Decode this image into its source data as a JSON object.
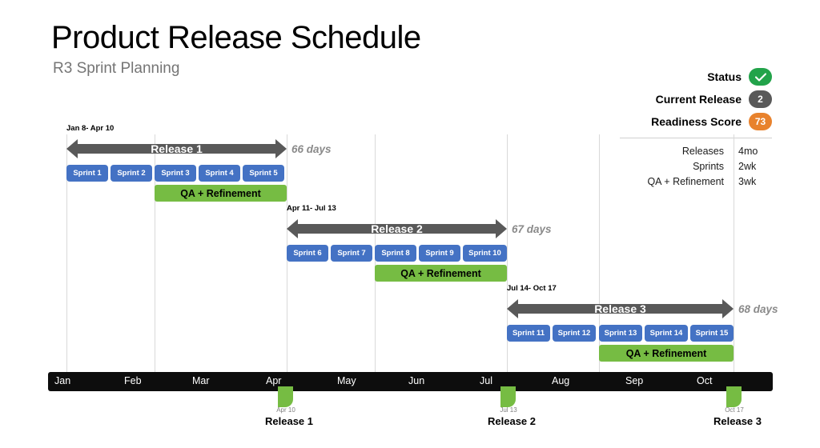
{
  "header": {
    "title": "Product Release Schedule",
    "subtitle": "R3 Sprint Planning"
  },
  "kpis": [
    {
      "label": "Status",
      "value": "",
      "icon": "check-icon",
      "color": "#22A34A",
      "style": "green"
    },
    {
      "label": "Current Release",
      "value": "2",
      "icon": "",
      "color": "#595959",
      "style": "gray"
    },
    {
      "label": "Readiness Score",
      "value": "73",
      "icon": "",
      "color": "#E8822D",
      "style": "orange"
    }
  ],
  "legend": {
    "rows": [
      {
        "name": "Releases",
        "value": "4mo"
      },
      {
        "name": "Sprints",
        "value": "2wk"
      },
      {
        "name": "QA + Refinement",
        "value": "3wk"
      }
    ]
  },
  "chart_data": {
    "type": "bar",
    "title": "Product Release Schedule",
    "subtitle": "R3 Sprint Planning",
    "xlabel": "",
    "ylabel": "",
    "axis": {
      "months": [
        "Jan",
        "Feb",
        "Mar",
        "Apr",
        "May",
        "Jun",
        "Jul",
        "Aug",
        "Sep",
        "Oct"
      ],
      "grid": true
    },
    "releases": [
      {
        "name": "Release 1",
        "date_range": "Jan 8- Apr 10",
        "duration_label": "66 days",
        "duration_days": 66,
        "start_month": "Jan",
        "end_month": "Apr",
        "sprints": [
          "Sprint 1",
          "Sprint 2",
          "Sprint 3",
          "Sprint 4",
          "Sprint 5"
        ],
        "qa_label": "QA + Refinement",
        "qa_start_sprint": 3,
        "qa_end_sprint": 5
      },
      {
        "name": "Release 2",
        "date_range": "Apr 11- Jul 13",
        "duration_label": "67 days",
        "duration_days": 67,
        "start_month": "Apr",
        "end_month": "Jul",
        "sprints": [
          "Sprint 6",
          "Sprint 7",
          "Sprint 8",
          "Sprint 9",
          "Sprint 10"
        ],
        "qa_label": "QA + Refinement",
        "qa_start_sprint": 3,
        "qa_end_sprint": 5
      },
      {
        "name": "Release 3",
        "date_range": "Jul 14- Oct 17",
        "duration_label": "68 days",
        "duration_days": 68,
        "start_month": "Jul",
        "end_month": "Oct",
        "sprints": [
          "Sprint 11",
          "Sprint 12",
          "Sprint 13",
          "Sprint 14",
          "Sprint 15"
        ],
        "qa_label": "QA + Refinement",
        "qa_start_sprint": 3,
        "qa_end_sprint": 5
      }
    ],
    "milestones": [
      {
        "date": "Apr 10",
        "name": "Release 1"
      },
      {
        "date": "Jul 13",
        "name": "Release 2"
      },
      {
        "date": "Oct 17",
        "name": "Release 3"
      }
    ],
    "colors": {
      "release_bar": "#595959",
      "sprint_bar": "#4472C4",
      "qa_bar": "#76BC43",
      "axis": "#0d0d0d",
      "milestone": "#76BC43"
    }
  }
}
